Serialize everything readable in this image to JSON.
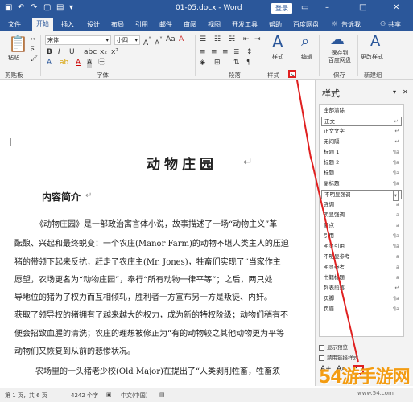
{
  "titlebar": {
    "doc_title": "01-05.docx - Word",
    "login": "登录"
  },
  "menu": [
    "文件",
    "开始",
    "插入",
    "设计",
    "布局",
    "引用",
    "邮件",
    "审阅",
    "视图",
    "开发工具",
    "帮助",
    "百度网盘",
    "告诉我",
    "共享"
  ],
  "ribbon": {
    "font_name": "宋体",
    "font_size": "小四",
    "paste": "粘贴",
    "clipboard": "剪贴板",
    "font_group": "字体",
    "para_group": "段落",
    "style_group": "样式",
    "styles": "样式",
    "edit": "编辑",
    "save_baidu": "保存到\n百度网盘",
    "change_style": "更改样式",
    "save_group": "保存",
    "new_group": "新建组",
    "bold": "B",
    "italic": "I",
    "underline": "U",
    "font_A": "A"
  },
  "document": {
    "title": "动物庄园",
    "subtitle": "内容简介",
    "lines": [
      "《动物庄园》是一部政治寓言体小说，故事描述了一场“动物主义”革",
      "酝酿、兴起和最终蜕变：一个农庄(Manor Farm)的动物不堪人类主人的压迫",
      "猪的带领下起来反抗，赶走了农庄主(Mr. Jones)，牲畜们实现了“当家作主",
      "愿望，农场更名为“动物庄园”，奉行“所有动物一律平等”；之后，两只处",
      "导地位的猪为了权力而互相倾轧，胜利者一方宣布另一方是叛徒、内奸。",
      "获取了领导权的猪拥有了越来越大的权力，成为新的特权阶级；动物们稍有不",
      "便会招致血腥的清洗；农庄的理想被修正为“有的动物较之其他动物更为平等",
      "动物们又恢复到从前的悲惨状况。",
      "农场里的一头猪老少校(Old Major)在提出了“人类剥削牲畜，牲畜须"
    ]
  },
  "pane": {
    "title": "样式",
    "styles": [
      {
        "name": "全部清除",
        "mark": ""
      },
      {
        "name": "正文",
        "mark": "↵"
      },
      {
        "name": "正文文字",
        "mark": "↵"
      },
      {
        "name": "无间隔",
        "mark": "↵"
      },
      {
        "name": "标题 1",
        "mark": "¶a"
      },
      {
        "name": "标题 2",
        "mark": "¶a"
      },
      {
        "name": "标题",
        "mark": "¶a"
      },
      {
        "name": "副标题",
        "mark": "¶a"
      },
      {
        "name": "不明显强调",
        "mark": "▾"
      },
      {
        "name": "强调",
        "mark": "a"
      },
      {
        "name": "明显强调",
        "mark": "a"
      },
      {
        "name": "要点",
        "mark": "a"
      },
      {
        "name": "引用",
        "mark": "¶a"
      },
      {
        "name": "明显引用",
        "mark": "¶a"
      },
      {
        "name": "不明显参考",
        "mark": "a"
      },
      {
        "name": "明显参考",
        "mark": "a"
      },
      {
        "name": "书籍标题",
        "mark": "a"
      },
      {
        "name": "列表段落",
        "mark": "↵"
      },
      {
        "name": "页脚",
        "mark": "¶a"
      },
      {
        "name": "页眉",
        "mark": "¶a"
      }
    ],
    "show_preview": "显示预览",
    "disable_linked": "禁用链接样式"
  },
  "status": {
    "page": "第 1 页，共 6 页",
    "words": "4242 个字",
    "lang": "中文(中国)"
  },
  "watermark": {
    "text": "54游手游网",
    "url": "www.54.com"
  },
  "colors": {
    "accent": "#2b579a",
    "highlight": "#e02020"
  }
}
